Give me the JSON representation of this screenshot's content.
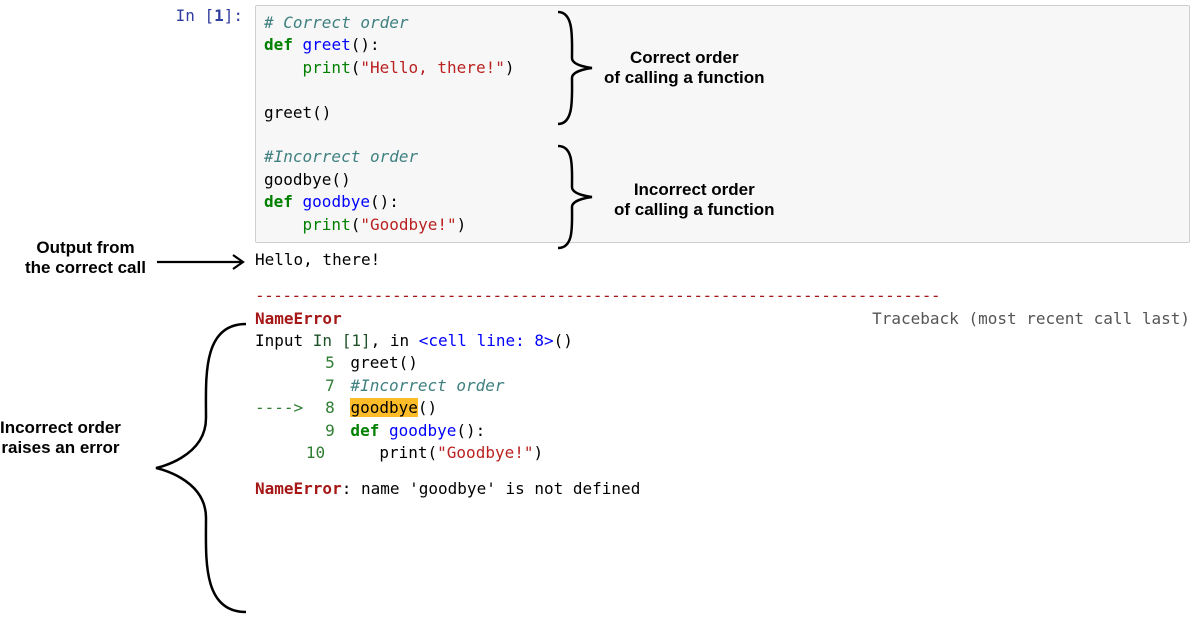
{
  "prompt": {
    "in": "In [",
    "num": "1",
    "close": "]:"
  },
  "code": {
    "l1_comment": "# Correct order",
    "l2_def": "def",
    "l2_name": " greet",
    "l2_rest": "():",
    "l3_print": "print",
    "l3_paren_open": "(",
    "l3_str": "\"Hello, there!\"",
    "l3_paren_close": ")",
    "l5_call": "greet()",
    "l7_comment": "#Incorrect order",
    "l8_call": "goodbye()",
    "l9_def": "def",
    "l9_name": " goodbye",
    "l9_rest": "():",
    "l10_print": "print",
    "l10_paren_open": "(",
    "l10_str": "\"Goodbye!\"",
    "l10_paren_close": ")"
  },
  "output": {
    "hello": "Hello, there!"
  },
  "error": {
    "dashes": "---------------------------------------------------------------------------",
    "name": "NameError",
    "traceback": "Traceback (most recent call last)",
    "input_pre": "Input ",
    "input_in": "In [1]",
    "input_mid": ", in ",
    "cell_line": "<cell line: 8>",
    "cell_post": "()",
    "tb5_n": "5",
    "tb5_txt": " greet()",
    "tb7_n": "7",
    "tb7_txt": " #Incorrect order",
    "tb8_arrow": "----> ",
    "tb8_n": "8",
    "tb8_goodbye": "goodbye",
    "tb8_rest": "()",
    "tb9_n": "9",
    "tb9_def": " def",
    "tb9_name": " goodbye",
    "tb9_rest": "():",
    "tb10_n": "10",
    "tb10_indent": "     ",
    "tb10_print": "print",
    "tb10_paren_open": "(",
    "tb10_str": "\"Goodbye!\"",
    "tb10_paren_close": ")",
    "final_name": "NameError",
    "final_msg": ": name 'goodbye' is not defined"
  },
  "annotations": {
    "correct_l1": "Correct order",
    "correct_l2": "of calling a function",
    "incorrect_l1": "Incorrect order",
    "incorrect_l2": "of calling a function",
    "output_l1": "Output from",
    "output_l2": "the correct call",
    "error_l1": "Incorrect order",
    "error_l2": "raises an error"
  }
}
